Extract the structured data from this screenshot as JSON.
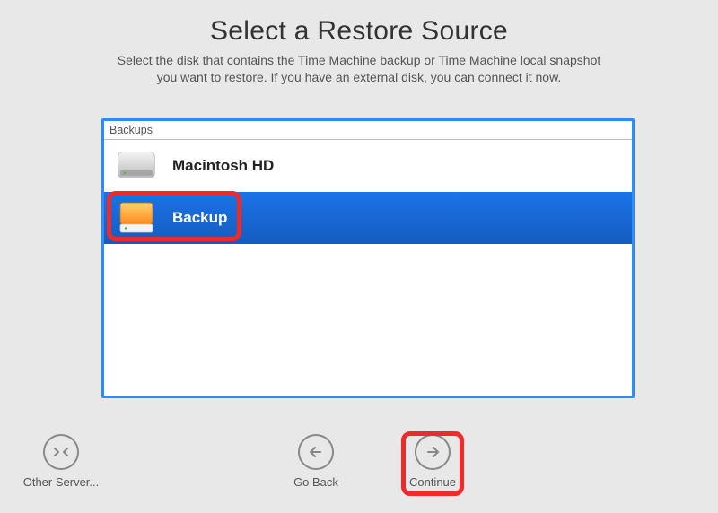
{
  "header": {
    "title": "Select a Restore Source",
    "subtitle_line1": "Select the disk that contains the Time Machine backup or Time Machine local snapshot",
    "subtitle_line2": "you want to restore. If you have an external disk, you can connect it now."
  },
  "panel": {
    "section_label": "Backups",
    "items": [
      {
        "label": "Macintosh HD",
        "selected": false,
        "icon": "internal-disk-icon"
      },
      {
        "label": "Backup",
        "selected": true,
        "icon": "external-disk-icon"
      }
    ]
  },
  "footer": {
    "other_server_label": "Other Server...",
    "go_back_label": "Go Back",
    "continue_label": "Continue"
  },
  "annotations": {
    "highlighted_item": "Backup",
    "highlighted_button": "Continue"
  },
  "colors": {
    "selection_blue": "#1c73e8",
    "panel_border": "#2a8cff",
    "highlight_red": "#ee2b2b"
  }
}
